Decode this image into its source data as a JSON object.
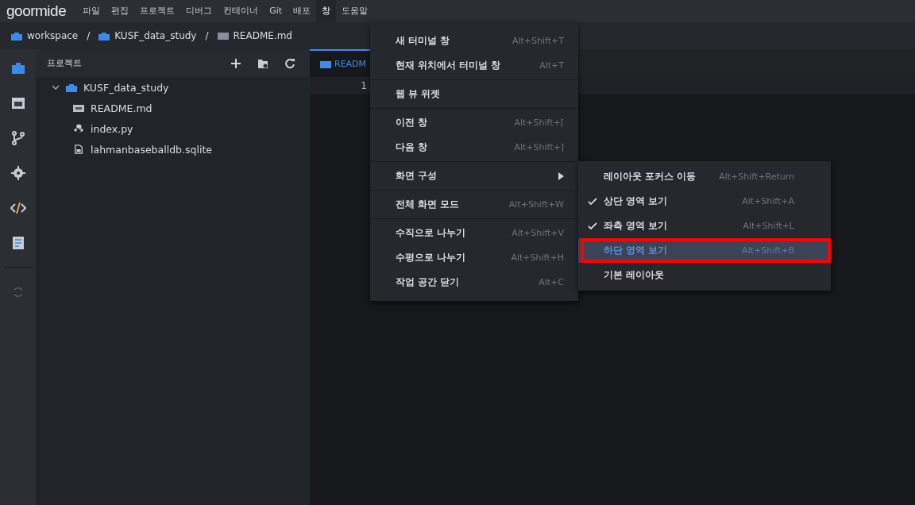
{
  "menubar": {
    "logo": "goormide",
    "items": [
      {
        "label": "파일",
        "selected": false
      },
      {
        "label": "편집",
        "selected": false
      },
      {
        "label": "프로젝트",
        "selected": false
      },
      {
        "label": "디버그",
        "selected": false
      },
      {
        "label": "컨테이너",
        "selected": false
      },
      {
        "label": "Git",
        "selected": false
      },
      {
        "label": "배포",
        "selected": false
      },
      {
        "label": "창",
        "selected": true
      },
      {
        "label": "도움말",
        "selected": false
      }
    ]
  },
  "breadcrumb": [
    {
      "label": "workspace",
      "kind": "folder"
    },
    {
      "label": "KUSF_data_study",
      "kind": "folder"
    },
    {
      "label": "README.md",
      "kind": "file"
    }
  ],
  "breadcrumb_separator": "/",
  "sidebar": {
    "title": "프로젝트",
    "tree": [
      {
        "label": "KUSF_data_study",
        "kind": "folder",
        "expanded": true,
        "children": [
          {
            "label": "README.md",
            "kind": "markdown"
          },
          {
            "label": "index.py",
            "kind": "python"
          },
          {
            "label": "lahmanbaseballdb.sqlite",
            "kind": "file"
          }
        ]
      }
    ]
  },
  "editor": {
    "tab": "READM",
    "line_numbers": [
      "1"
    ]
  },
  "window_menu": {
    "groups": [
      [
        {
          "label": "새 터미널 창",
          "shortcut": "Alt+Shift+T"
        },
        {
          "label": "현재 위치에서 터미널 창",
          "shortcut": "Alt+T"
        }
      ],
      [
        {
          "label": "웹 뷰 위젯"
        }
      ],
      [
        {
          "label": "이전 창",
          "shortcut": "Alt+Shift+["
        },
        {
          "label": "다음 창",
          "shortcut": "Alt+Shift+]"
        }
      ],
      [
        {
          "label": "화면 구성",
          "has_submenu": true
        }
      ],
      [
        {
          "label": "전체 화면 모드",
          "shortcut": "Alt+Shift+W"
        }
      ],
      [
        {
          "label": "수직으로 나누기",
          "shortcut": "Alt+Shift+V"
        },
        {
          "label": "수평으로 나누기",
          "shortcut": "Alt+Shift+H"
        },
        {
          "label": "작업 공간 닫기",
          "shortcut": "Alt+C"
        }
      ]
    ]
  },
  "layout_submenu": [
    {
      "label": "레이아웃 포커스 이동",
      "shortcut": "Alt+Shift+Return",
      "checked": false,
      "selected": false
    },
    {
      "label": "상단 영역 보기",
      "shortcut": "Alt+Shift+A",
      "checked": true,
      "selected": false
    },
    {
      "label": "좌측 영역 보기",
      "shortcut": "Alt+Shift+L",
      "checked": true,
      "selected": false
    },
    {
      "label": "하단 영역 보기",
      "shortcut": "Alt+Shift+B",
      "checked": false,
      "selected": true
    },
    {
      "label": "기본 레이아웃",
      "checked": false,
      "selected": false
    }
  ]
}
